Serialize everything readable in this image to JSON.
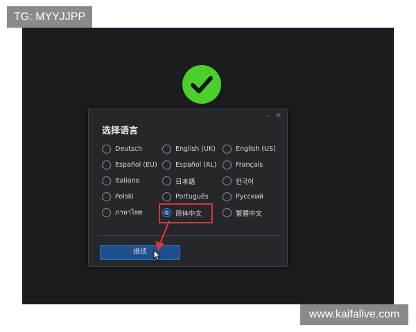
{
  "watermarks": {
    "top_left": "TG: MYYJJPP",
    "bottom_right": "www.kaifalive.com"
  },
  "screen": {
    "background": "#1b1c20",
    "success_icon": {
      "name": "checkmark-circle-icon",
      "color": "#4cce2b"
    }
  },
  "dialog": {
    "title": "选择语言",
    "window_controls": {
      "minimize": "–",
      "close": "×"
    },
    "languages": [
      {
        "label": "Deutsch",
        "selected": false
      },
      {
        "label": "English (UK)",
        "selected": false
      },
      {
        "label": "English (US)",
        "selected": false
      },
      {
        "label": "Español (EU)",
        "selected": false
      },
      {
        "label": "Español (AL)",
        "selected": false
      },
      {
        "label": "Français",
        "selected": false
      },
      {
        "label": "Italiano",
        "selected": false
      },
      {
        "label": "日本語",
        "selected": false
      },
      {
        "label": "한국어",
        "selected": false
      },
      {
        "label": "Polski",
        "selected": false
      },
      {
        "label": "Português",
        "selected": false
      },
      {
        "label": "Русский",
        "selected": false
      },
      {
        "label": "ภาษาไทย",
        "selected": false
      },
      {
        "label": "简体中文",
        "selected": true
      },
      {
        "label": "繁體中文",
        "selected": false
      }
    ],
    "continue_label": "继续"
  },
  "colors": {
    "accent": "#4d90e3",
    "button": "#1f4f8c",
    "highlight_annotation": "#e0343a"
  }
}
